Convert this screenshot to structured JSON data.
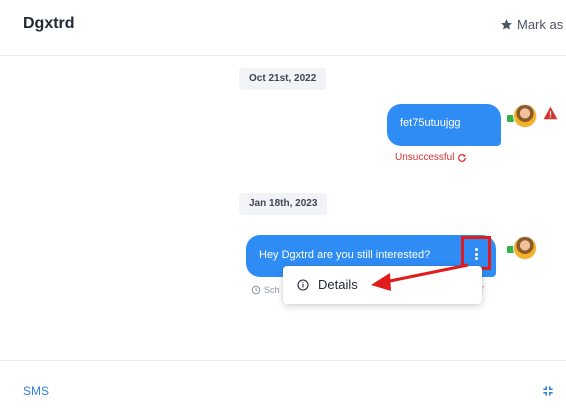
{
  "header": {
    "title": "Dgxtrd",
    "mark_as_label": "Mark as"
  },
  "conversation": [
    {
      "date": "Oct 21st, 2022",
      "message": "fet75utuujgg",
      "status": "Unsuccessful"
    },
    {
      "date": "Jan 18th, 2023",
      "message": "Hey Dgxtrd are you still interested?",
      "scheduled_label_start": "Sch",
      "scheduled_label_end": "T"
    }
  ],
  "context_menu": {
    "items": [
      {
        "label": "Details",
        "icon": "info-icon"
      }
    ]
  },
  "footer": {
    "channel_label": "SMS",
    "collapse_icon": "collapse-icon"
  },
  "colors": {
    "accent": "#2f8cf5",
    "error": "#d93030",
    "highlight": "#e01b1b",
    "sms_flag": "#34b24a"
  }
}
